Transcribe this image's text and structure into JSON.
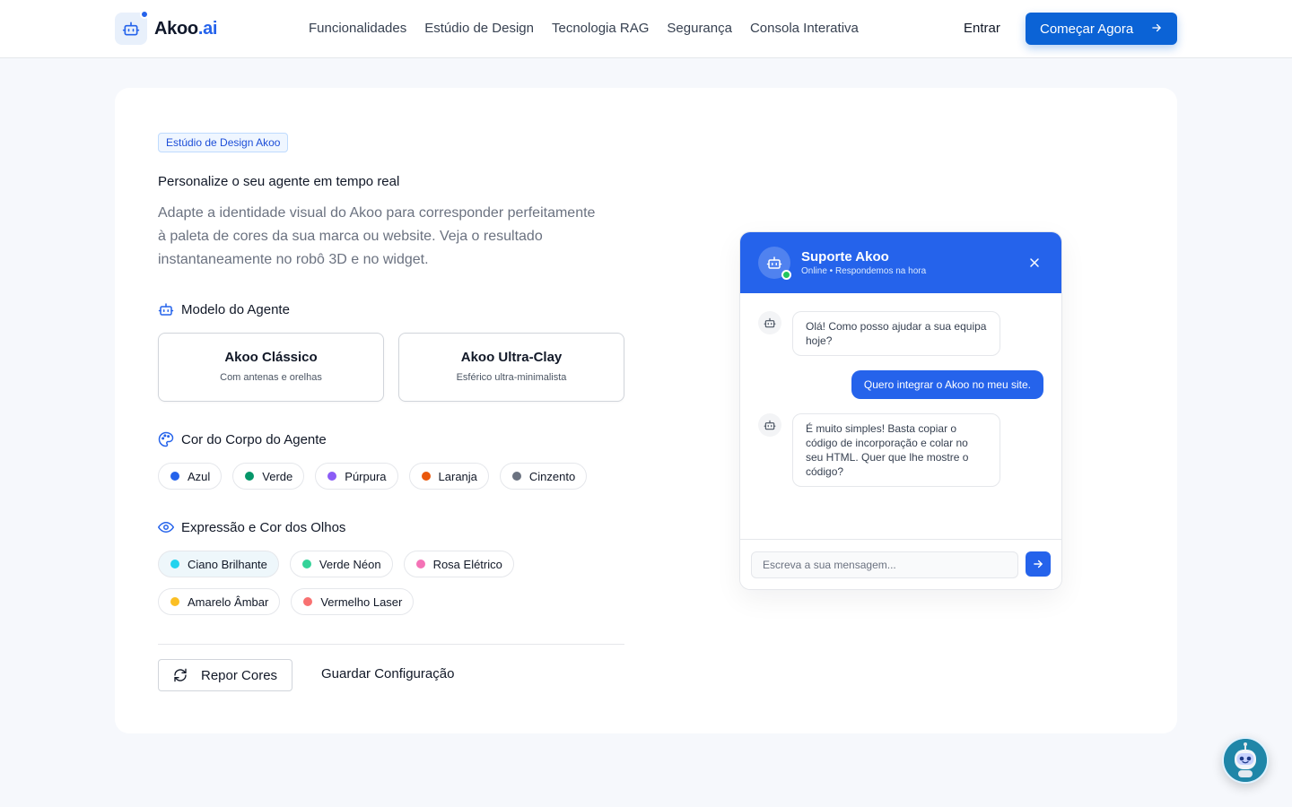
{
  "nav": {
    "logo_name": "Akoo",
    "logo_suffix": ".ai",
    "links": [
      "Funcionalidades",
      "Estúdio de Design",
      "Tecnologia RAG",
      "Segurança",
      "Consola Interativa"
    ],
    "login": "Entrar",
    "cta": "Começar Agora"
  },
  "studio": {
    "badge": "Estúdio de Design Akoo",
    "title": "Personalize o seu agente em tempo real",
    "lead": "Adapte a identidade visual do Akoo para corresponder perfeitamente à paleta de cores da sua marca ou website. Veja o resultado instantaneamente no robô 3D e no widget.",
    "model_label": "Modelo do Agente",
    "models": [
      {
        "name": "Akoo Clássico",
        "desc": "Com antenas e orelhas"
      },
      {
        "name": "Akoo Ultra-Clay",
        "desc": "Esférico ultra-minimalista"
      }
    ],
    "body_label": "Cor do Corpo do Agente",
    "body_colors": [
      {
        "name": "Azul",
        "color": "#2563eb"
      },
      {
        "name": "Verde",
        "color": "#059669"
      },
      {
        "name": "Púrpura",
        "color": "#8b5cf6"
      },
      {
        "name": "Laranja",
        "color": "#ea580c"
      },
      {
        "name": "Cinzento",
        "color": "#6b7280"
      }
    ],
    "eye_label": "Expressão e Cor dos Olhos",
    "eye_colors": [
      {
        "name": "Ciano Brilhante",
        "color": "#22d3ee"
      },
      {
        "name": "Verde Néon",
        "color": "#34d399"
      },
      {
        "name": "Rosa Elétrico",
        "color": "#f472b6"
      },
      {
        "name": "Amarelo Âmbar",
        "color": "#fbbf24"
      },
      {
        "name": "Vermelho Laser",
        "color": "#f87171"
      }
    ],
    "reset": "Repor Cores",
    "save": "Guardar Configuração"
  },
  "widget": {
    "title": "Suporte Akoo",
    "subtitle": "Online • Respondemos na hora",
    "messages": [
      {
        "from": "bot",
        "text": "Olá! Como posso ajudar a sua equipa hoje?"
      },
      {
        "from": "user",
        "text": "Quero integrar o Akoo no meu site."
      },
      {
        "from": "bot",
        "text": "É muito simples! Basta copiar o código de incorporação e colar no seu HTML. Quer que lhe mostre o código?"
      }
    ],
    "input_placeholder": "Escreva a sua mensagem..."
  },
  "colors": {
    "accent": "#2563eb",
    "cta": "#0b63d6"
  }
}
